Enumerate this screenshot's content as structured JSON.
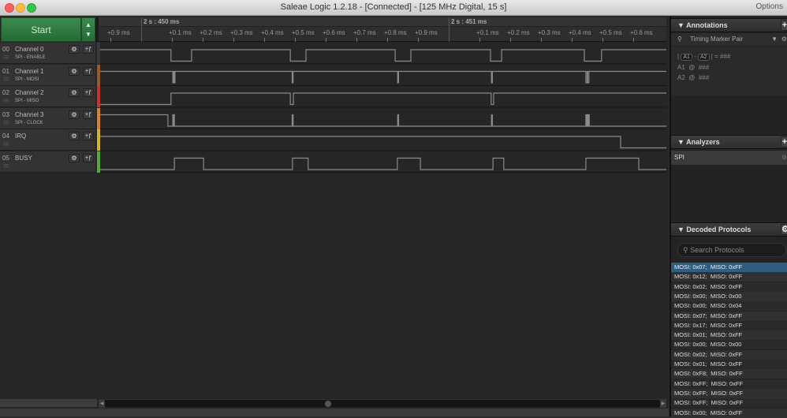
{
  "window": {
    "title": "Saleae Logic 1.2.18 - [Connected] - [125 MHz Digital, 15 s]",
    "options_label": "Options"
  },
  "toolbar": {
    "start_label": "Start"
  },
  "timeline": {
    "markers": [
      {
        "label": "2 s : 450 ms",
        "t": 0
      },
      {
        "label": "2 s : 451 ms",
        "t": 1
      }
    ],
    "ticks": [
      {
        "label": "+0.9 ms",
        "t": -0.1
      },
      {
        "label": "+0.1 ms",
        "t": 0.1
      },
      {
        "label": "+0.2 ms",
        "t": 0.2
      },
      {
        "label": "+0.3 ms",
        "t": 0.3
      },
      {
        "label": "+0.4 ms",
        "t": 0.4
      },
      {
        "label": "+0.5 ms",
        "t": 0.5
      },
      {
        "label": "+0.6 ms",
        "t": 0.6
      },
      {
        "label": "+0.7 ms",
        "t": 0.7
      },
      {
        "label": "+0.8 ms",
        "t": 0.8
      },
      {
        "label": "+0.9 ms",
        "t": 0.9
      },
      {
        "label": "+0.1 ms",
        "t": 1.1
      },
      {
        "label": "+0.2 ms",
        "t": 1.2
      },
      {
        "label": "+0.3 ms",
        "t": 1.3
      },
      {
        "label": "+0.4 ms",
        "t": 1.4
      },
      {
        "label": "+0.5 ms",
        "t": 1.5
      },
      {
        "label": "+0.6 ms",
        "t": 1.6
      }
    ],
    "view_start_ms": -0.13,
    "view_end_ms": 1.71
  },
  "channels": [
    {
      "num": "00",
      "name": "Channel 0",
      "sub": "SPI - ENABLE",
      "color": "#3a3a3a",
      "init": 1,
      "edges": [
        0.097,
        0.164,
        0.485,
        0.536,
        0.826,
        0.877,
        1.136,
        1.172,
        1.441,
        1.497
      ]
    },
    {
      "num": "01",
      "name": "Channel 1",
      "sub": "SPI - MOSI",
      "color": "#9a5a28",
      "init": 1,
      "edges": [
        0.103,
        0.106,
        0.107,
        0.11,
        0.491,
        0.494,
        0.834,
        0.837,
        1.139,
        1.142,
        1.446,
        1.45,
        1.452,
        1.456
      ]
    },
    {
      "num": "02",
      "name": "Channel 2",
      "sub": "SPI - MISO",
      "color": "#c8322a",
      "init": 0,
      "edges": [
        0.097,
        0.485,
        0.495,
        1.138,
        1.146
      ]
    },
    {
      "num": "03",
      "name": "Channel 3",
      "sub": "SPI - CLOCK",
      "color": "#d8822a",
      "init": 1,
      "edges": [
        0.087,
        0.103,
        0.105,
        0.106,
        0.108,
        0.491,
        0.494,
        0.834,
        0.837,
        1.139,
        1.142,
        1.446,
        1.449,
        1.45,
        1.453,
        1.454,
        1.457
      ]
    },
    {
      "num": "04",
      "name": "IRQ",
      "sub": "",
      "color": "#d6b428",
      "init": 1,
      "edges": [
        1.559
      ]
    },
    {
      "num": "05",
      "name": "BUSY",
      "sub": "",
      "color": "#5aa83a",
      "init": 0,
      "edges": [
        0.108,
        0.203,
        0.492,
        0.543,
        0.833,
        0.908,
        1.144,
        1.179,
        1.446,
        1.618
      ]
    }
  ],
  "panels": {
    "annotations": {
      "title": "Annotations",
      "add": "+",
      "mode": "Timing Marker Pair",
      "formula": {
        "a1": "A1",
        "a2": "A2",
        "result": "= ###"
      },
      "rows": [
        {
          "label": "A1",
          "at": "@",
          "value": "###"
        },
        {
          "label": "A2",
          "at": "@",
          "value": "###"
        }
      ]
    },
    "analyzers": {
      "title": "Analyzers",
      "add": "+",
      "items": [
        {
          "name": "SPI"
        }
      ]
    },
    "decoded": {
      "title": "Decoded Protocols",
      "search_placeholder": "Search Protocols",
      "rows": [
        "MOSI: 0x07;  MISO: 0xFF",
        "MOSI: 0x12;  MISO: 0xFF",
        "MOSI: 0x02;  MISO: 0xFF",
        "MOSI: 0x00;  MISO: 0x00",
        "MOSI: 0x00;  MISO: 0x04",
        "MOSI: 0x07;  MISO: 0xFF",
        "MOSI: 0x17;  MISO: 0xFF",
        "MOSI: 0x01;  MISO: 0xFF",
        "MOSI: 0x00;  MISO: 0x00",
        "MOSI: 0x02;  MISO: 0xFF",
        "MOSI: 0x01;  MISO: 0xFF",
        "MOSI: 0xF8;  MISO: 0xFF",
        "MOSI: 0xFF;  MISO: 0xFF",
        "MOSI: 0xFF;  MISO: 0xFF",
        "MOSI: 0xFF;  MISO: 0xFF",
        "MOSI: 0x00;  MISO: 0xFF"
      ],
      "selected_index": 0
    }
  }
}
